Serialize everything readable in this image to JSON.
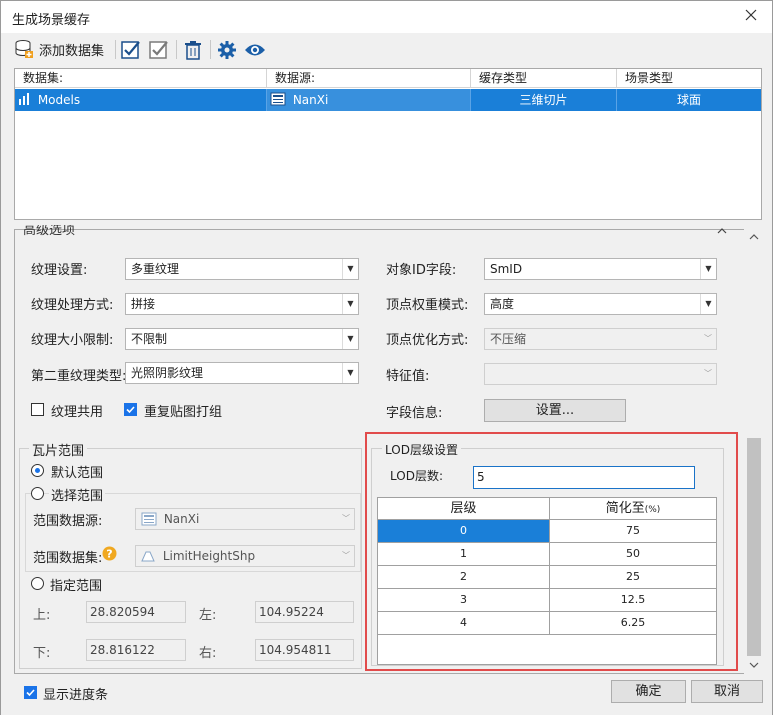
{
  "window": {
    "title": "生成场景缓存"
  },
  "toolbar": {
    "add_dataset": "添加数据集"
  },
  "dataset_grid": {
    "headers": [
      "数据集:",
      "数据源:",
      "缓存类型",
      "场景类型"
    ],
    "rows": [
      {
        "dataset": "Models",
        "datasource": "NanXi",
        "cache_type": "三维切片",
        "scene_type": "球面"
      }
    ]
  },
  "advanced": {
    "section_title": "高级选项",
    "texture_setting": {
      "label": "纹理设置:",
      "value": "多重纹理"
    },
    "texture_process": {
      "label": "纹理处理方式:",
      "value": "拼接"
    },
    "texture_size_limit": {
      "label": "纹理大小限制:",
      "value": "不限制"
    },
    "second_texture_type": {
      "label": "第二重纹理类型:",
      "value": "光照阴影纹理"
    },
    "object_id_field": {
      "label": "对象ID字段:",
      "value": "SmID"
    },
    "vertex_weight_mode": {
      "label": "顶点权重模式:",
      "value": "高度"
    },
    "vertex_optimize": {
      "label": "顶点优化方式:",
      "value": "不压缩"
    },
    "feature_value": {
      "label": "特征值:",
      "value": ""
    },
    "field_info": {
      "label": "字段信息:",
      "button": "设置..."
    },
    "texture_share": {
      "label": "纹理共用",
      "checked": false
    },
    "repeat_texture_pack": {
      "label": "重复贴图打组",
      "checked": true
    }
  },
  "tile_range": {
    "title": "瓦片范围",
    "default_range": "默认范围",
    "select_range": "选择范围",
    "range_datasource_label": "范围数据源:",
    "range_datasource_value": "NanXi",
    "range_dataset_label": "范围数据集:",
    "range_dataset_value": "LimitHeightShp",
    "specified_range": "指定范围",
    "top_label": "上:",
    "top_value": "28.820594",
    "left_label": "左:",
    "left_value": "104.95224",
    "bottom_label": "下:",
    "bottom_value": "28.816122",
    "right_label": "右:",
    "right_value": "104.954811"
  },
  "lod": {
    "title": "LOD层级设置",
    "count_label": "LOD层数:",
    "count_value": "5",
    "col_level": "层级",
    "col_simplify": "简化至",
    "col_simplify_unit": "(%)",
    "rows": [
      {
        "level": "0",
        "simplify": "75"
      },
      {
        "level": "1",
        "simplify": "50"
      },
      {
        "level": "2",
        "simplify": "25"
      },
      {
        "level": "3",
        "simplify": "12.5"
      },
      {
        "level": "4",
        "simplify": "6.25"
      }
    ]
  },
  "footer": {
    "show_progress": "显示进度条",
    "ok": "确定",
    "cancel": "取消"
  },
  "colors": {
    "accent": "#1a7fd8",
    "highlight_border": "#e14b4b"
  }
}
